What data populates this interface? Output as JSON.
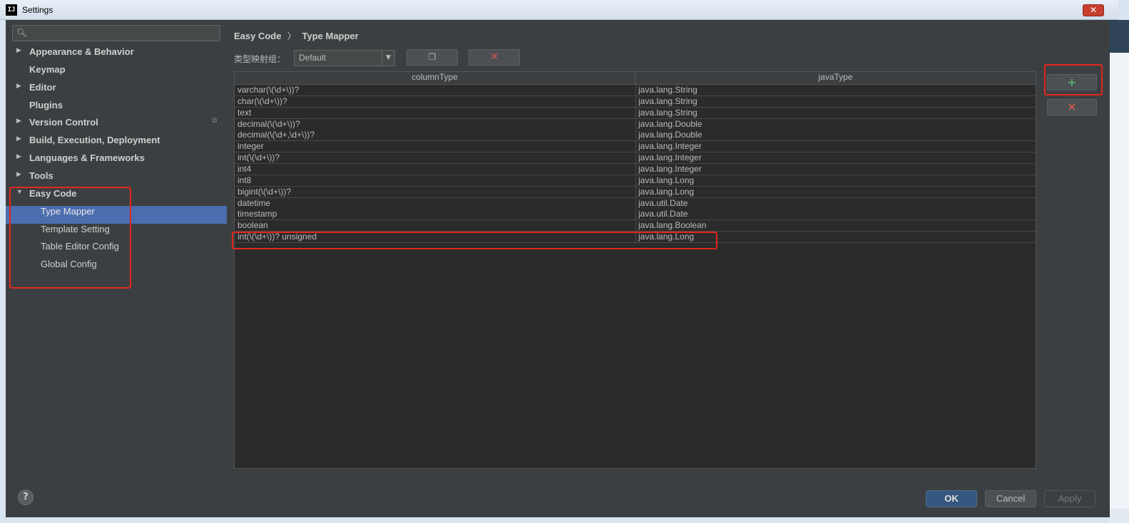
{
  "window": {
    "title": "Settings",
    "app_icon_text": "IJ",
    "close_symbol": "✕"
  },
  "sidebar": {
    "search_placeholder": "",
    "items": [
      {
        "label": "Appearance & Behavior",
        "arrow": "▶"
      },
      {
        "label": "Keymap",
        "arrow": ""
      },
      {
        "label": "Editor",
        "arrow": "▶"
      },
      {
        "label": "Plugins",
        "arrow": ""
      },
      {
        "label": "Version Control",
        "arrow": "▶"
      },
      {
        "label": "Build, Execution, Deployment",
        "arrow": "▶"
      },
      {
        "label": "Languages & Frameworks",
        "arrow": "▶"
      },
      {
        "label": "Tools",
        "arrow": "▶"
      },
      {
        "label": "Easy Code",
        "arrow": "▼"
      }
    ],
    "easy_code_children": [
      {
        "label": "Type Mapper"
      },
      {
        "label": "Template Setting"
      },
      {
        "label": "Table Editor Config"
      },
      {
        "label": "Global Config"
      }
    ],
    "selected": "Type Mapper"
  },
  "breadcrumb": {
    "parent": "Easy Code",
    "separator": "〉",
    "current": "Type Mapper"
  },
  "group_selector": {
    "label": "类型映射组：",
    "value": "Default",
    "arrow": "▼"
  },
  "toolbar": {
    "copy_symbol": "❐",
    "delete_symbol": "✕"
  },
  "table": {
    "columns": [
      "columnType",
      "javaType"
    ],
    "rows": [
      [
        "varchar(\\(\\d+\\))?",
        "java.lang.String"
      ],
      [
        "char(\\(\\d+\\))?",
        "java.lang.String"
      ],
      [
        "text",
        "java.lang.String"
      ],
      [
        "decimal(\\(\\d+\\))?",
        "java.lang.Double"
      ],
      [
        "decimal(\\(\\d+,\\d+\\))?",
        "java.lang.Double"
      ],
      [
        "integer",
        "java.lang.Integer"
      ],
      [
        "int(\\(\\d+\\))?",
        "java.lang.Integer"
      ],
      [
        "int4",
        "java.lang.Integer"
      ],
      [
        "int8",
        "java.lang.Long"
      ],
      [
        "bigint(\\(\\d+\\))?",
        "java.lang.Long"
      ],
      [
        "datetime",
        "java.util.Date"
      ],
      [
        "timestamp",
        "java.util.Date"
      ],
      [
        "boolean",
        "java.lang.Boolean"
      ],
      [
        "int(\\(\\d+\\))? unsigned",
        "java.lang.Long"
      ]
    ]
  },
  "side_buttons": {
    "add_symbol": "+",
    "remove_symbol": "✕"
  },
  "footer": {
    "help_symbol": "?",
    "ok_label": "OK",
    "cancel_label": "Cancel",
    "apply_label": "Apply"
  },
  "colors": {
    "background": "#3c3f41",
    "selection": "#4b6eaf",
    "highlight_box": "#e3261c",
    "add_green": "#59a869",
    "delete_red": "#e05555"
  }
}
